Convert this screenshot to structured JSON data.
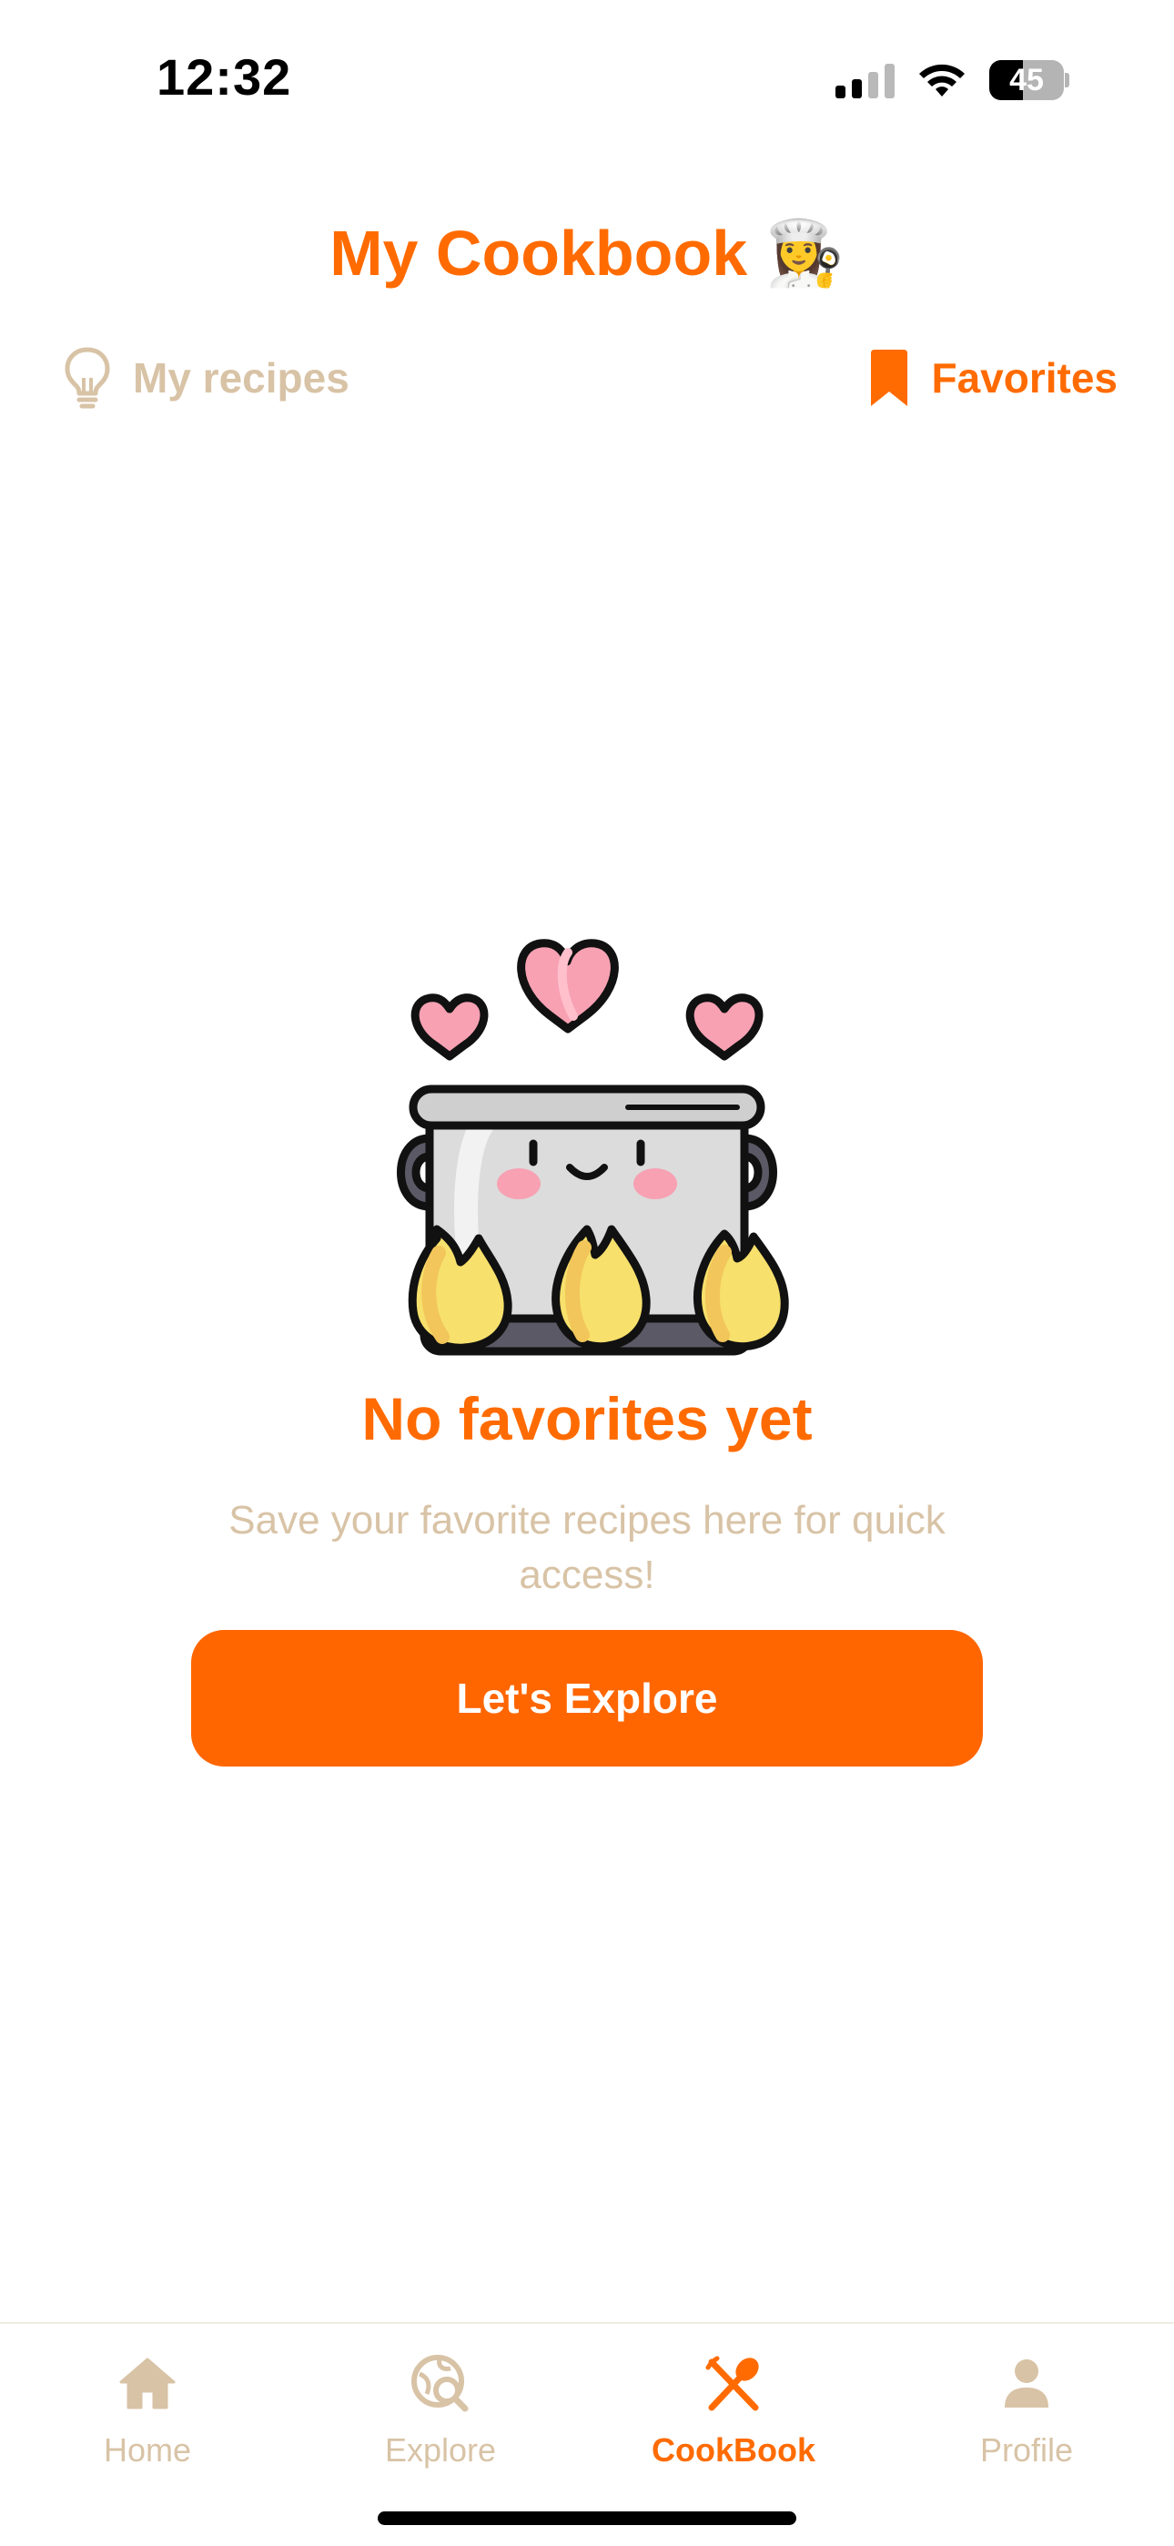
{
  "status_bar": {
    "time": "12:32",
    "battery": "45",
    "battery_level": 0.45
  },
  "header": {
    "title": "My Cookbook",
    "title_emoji": "👩‍🍳"
  },
  "tabs": [
    {
      "label": "My recipes",
      "icon": "lightbulb-icon",
      "active": false
    },
    {
      "label": "Favorites",
      "icon": "bookmark-icon",
      "active": true
    }
  ],
  "empty_state": {
    "title": "No favorites yet",
    "subtitle": "Save your favorite recipes here for quick access!",
    "button_label": "Let's Explore",
    "illustration": "happy-cooking-pot-illustration"
  },
  "bottom_nav": [
    {
      "label": "Home",
      "icon": "home-icon",
      "active": false
    },
    {
      "label": "Explore",
      "icon": "explore-icon",
      "active": false
    },
    {
      "label": "CookBook",
      "icon": "cookbook-icon",
      "active": true
    },
    {
      "label": "Profile",
      "icon": "profile-icon",
      "active": false
    }
  ],
  "colors": {
    "accent": "#ff6b00",
    "button": "#ff6600",
    "muted": "#d8c3a6"
  }
}
